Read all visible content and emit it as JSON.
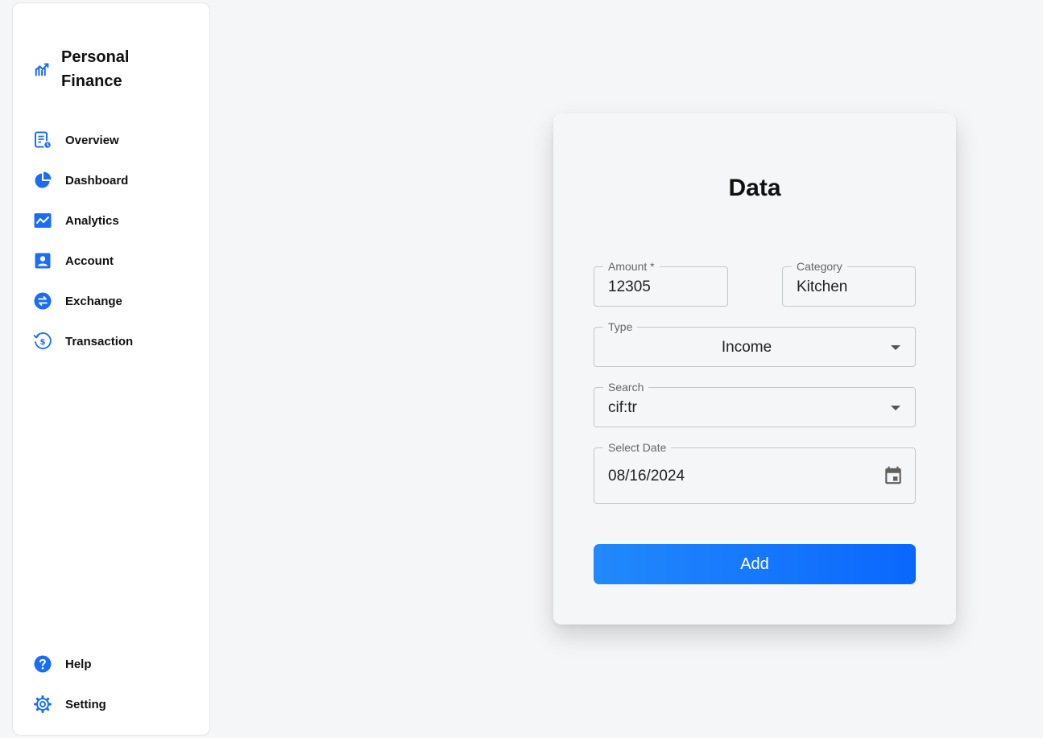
{
  "app": {
    "title": "Personal Finance",
    "icon": "trending-chart-icon"
  },
  "colors": {
    "accent": "#1a6ef5",
    "button_start": "#2289fb",
    "button_end": "#0a67fd"
  },
  "sidebar": {
    "items": [
      {
        "label": "Overview",
        "icon": "overview-icon"
      },
      {
        "label": "Dashboard",
        "icon": "pie-chart-icon"
      },
      {
        "label": "Analytics",
        "icon": "analytics-icon"
      },
      {
        "label": "Account",
        "icon": "account-icon"
      },
      {
        "label": "Exchange",
        "icon": "exchange-icon"
      },
      {
        "label": "Transaction",
        "icon": "transaction-icon"
      }
    ],
    "bottom": [
      {
        "label": "Help",
        "icon": "help-icon"
      },
      {
        "label": "Setting",
        "icon": "gear-icon"
      }
    ]
  },
  "form": {
    "title": "Data",
    "amount": {
      "label": "Amount *",
      "value": "12305"
    },
    "category": {
      "label": "Category",
      "value": "Kitchen"
    },
    "type": {
      "label": "Type",
      "value": "Income"
    },
    "search": {
      "label": "Search",
      "value": "cif:tr"
    },
    "date": {
      "label": "Select Date",
      "value": "08/16/2024"
    },
    "submit_label": "Add"
  }
}
